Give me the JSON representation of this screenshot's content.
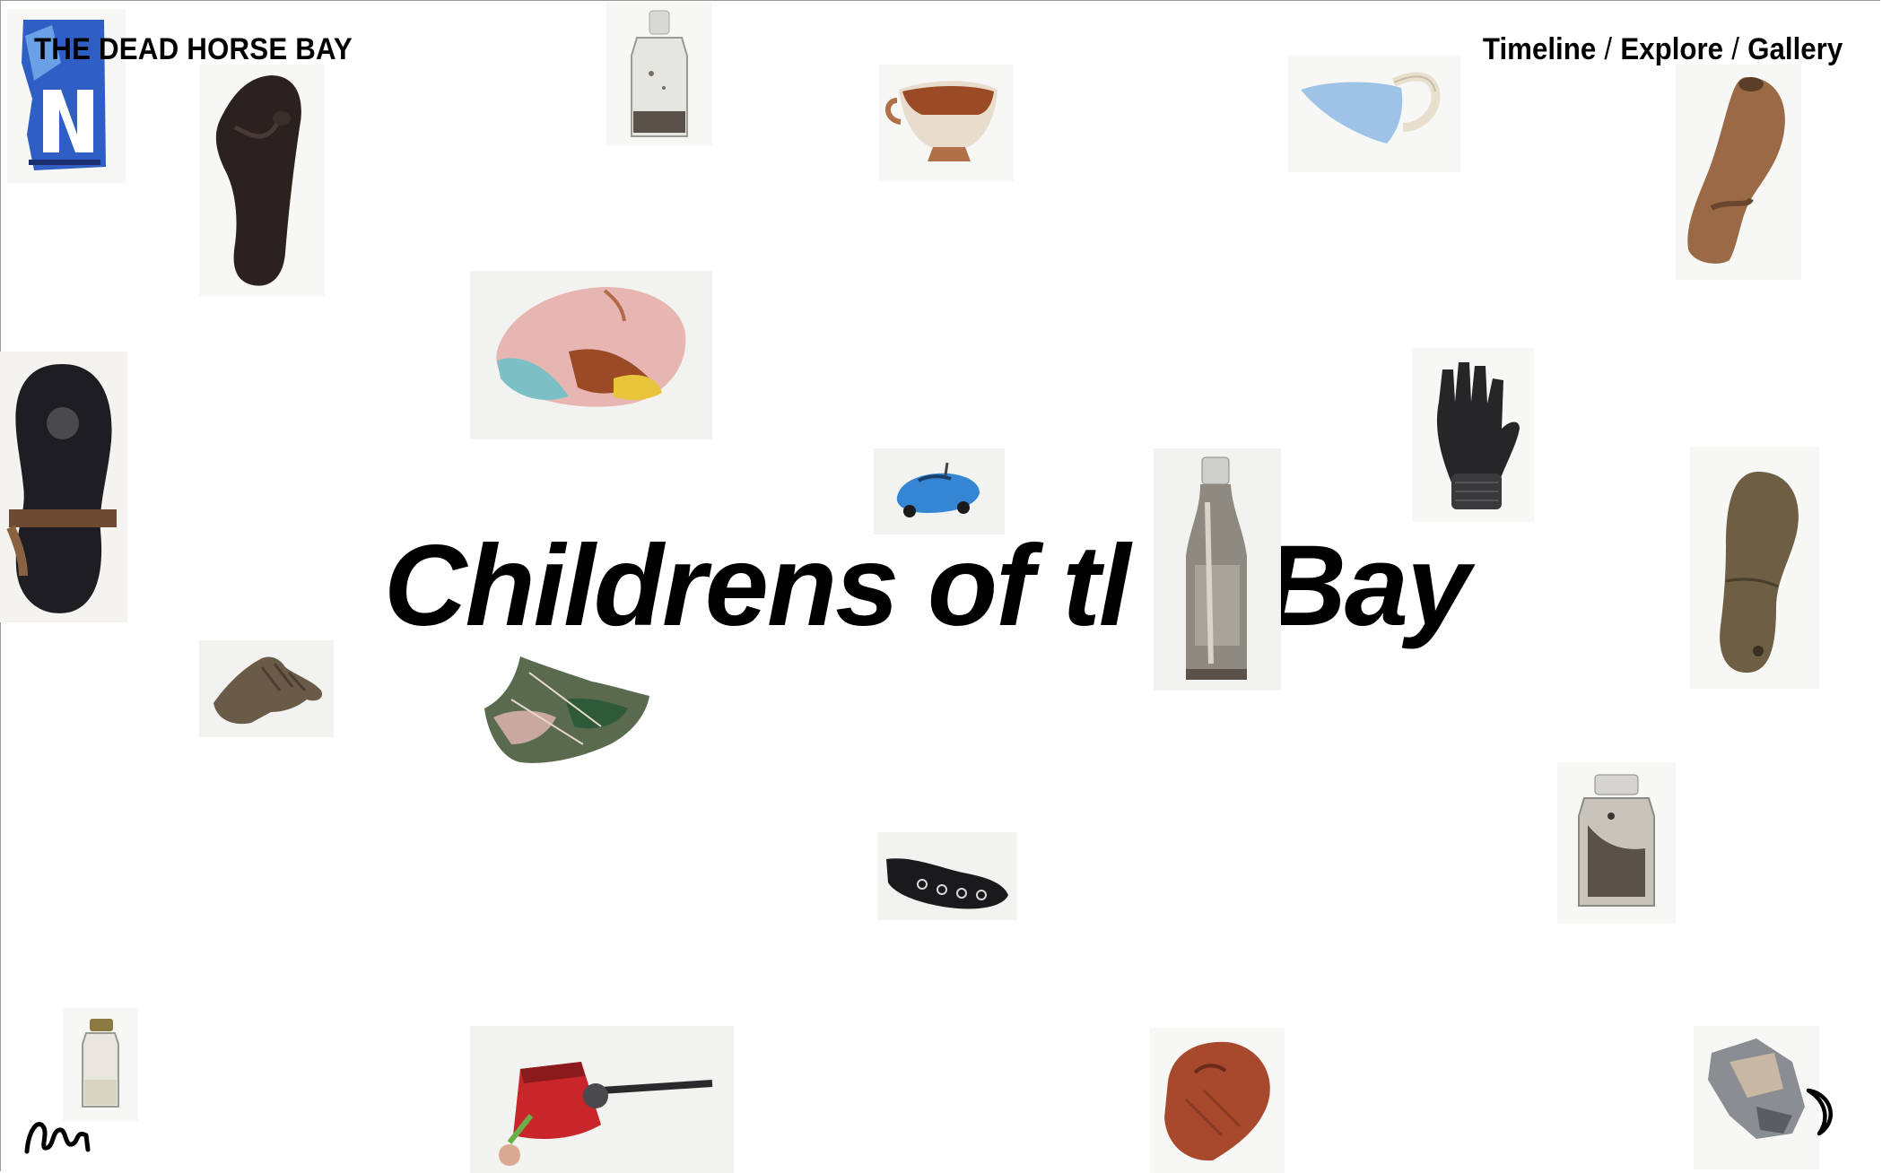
{
  "header": {
    "brand": "THE DEAD HORSE BAY",
    "nav": {
      "timeline": "Timeline",
      "explore": "Explore",
      "gallery": "Gallery",
      "separator": "/"
    }
  },
  "hero": {
    "title_part1": "Childrens of t",
    "title_part2": "l",
    "title_part3": "Bay"
  },
  "artifacts": [
    "license-plate-fragment",
    "flip-flop-sandal",
    "clear-glass-bottle",
    "broken-teacup",
    "blue-ceramic-shard-with-rope",
    "worn-boot-sole",
    "painted-ceramic-bowl-fragment",
    "shoe-sole",
    "fingerless-knit-glove",
    "blue-toy-car",
    "glass-bottle-neck",
    "leather-shoe-insole",
    "leather-work-glove",
    "crumpled-painted-tin",
    "black-beaded-shoe",
    "glass-jar",
    "small-glass-vial",
    "red-toy-bell",
    "terracotta-stamp-fragment",
    "torn-metal-scrap"
  ],
  "icons": {
    "bottom_left": "squiggle-icon",
    "bottom_right": "moon-icon"
  }
}
